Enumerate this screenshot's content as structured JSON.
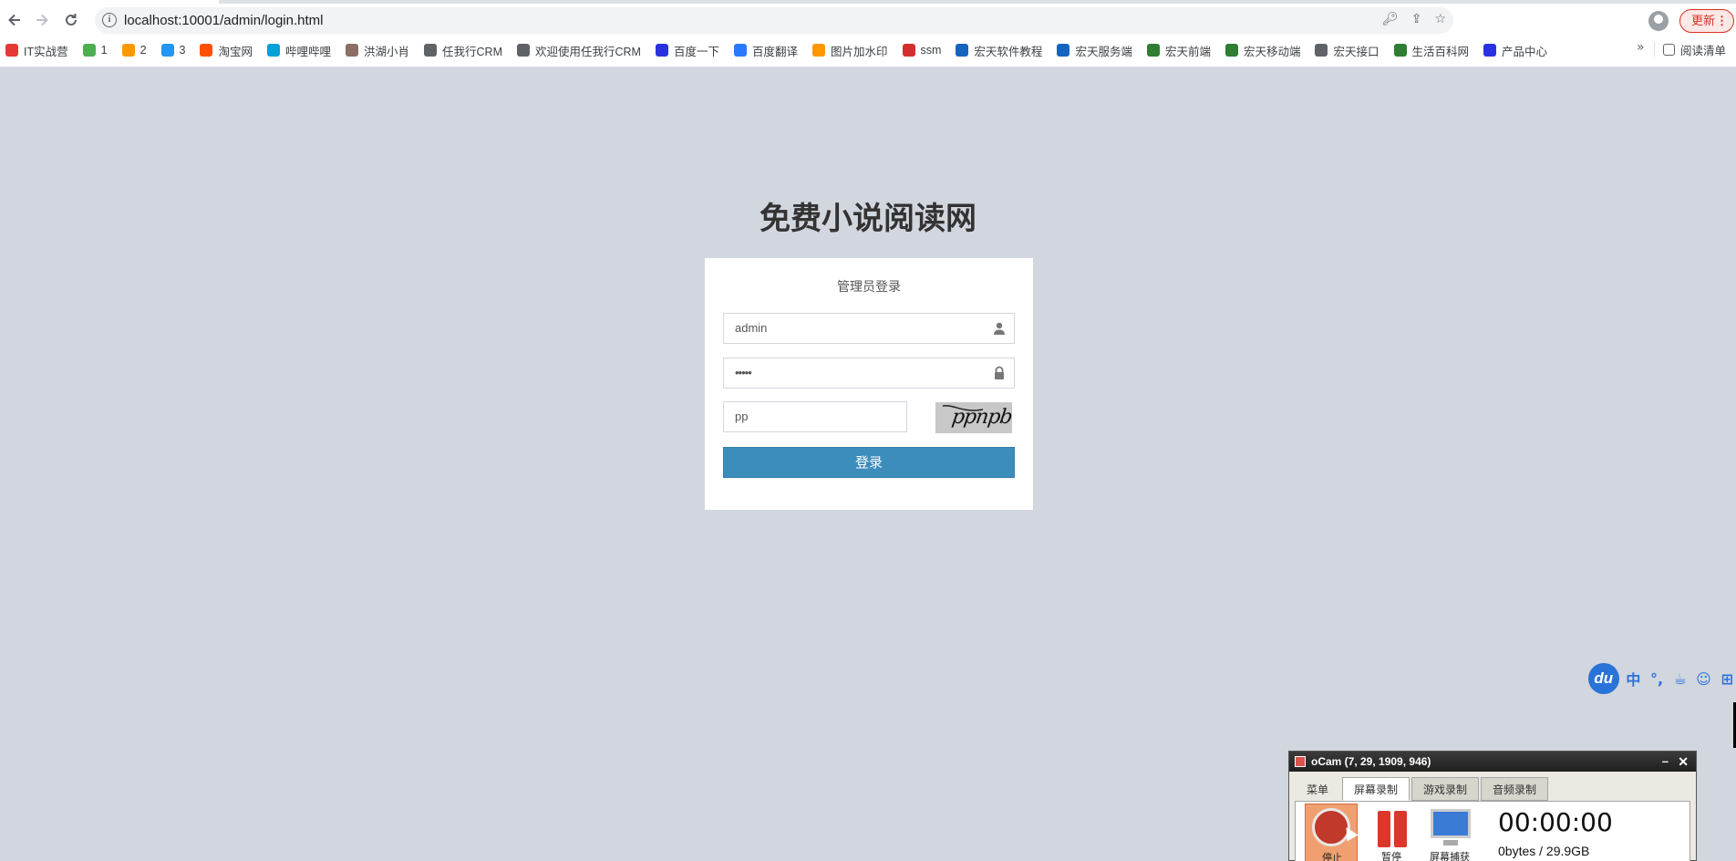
{
  "browser": {
    "url": "localhost:10001/admin/login.html",
    "update_label": "更新",
    "bookmarks": [
      {
        "label": "IT实战营",
        "color": "#e53935"
      },
      {
        "label": "1",
        "color": "#4caf50"
      },
      {
        "label": "2",
        "color": "#ff9800"
      },
      {
        "label": "3",
        "color": "#2196f3"
      },
      {
        "label": "淘宝网",
        "color": "#ff5000"
      },
      {
        "label": "哔哩哔哩",
        "color": "#00a1d6"
      },
      {
        "label": "洪湖小肖",
        "color": "#8d6e63"
      },
      {
        "label": "任我行CRM",
        "color": "#5f6368"
      },
      {
        "label": "欢迎使用任我行CRM",
        "color": "#5f6368"
      },
      {
        "label": "百度一下",
        "color": "#2932e1"
      },
      {
        "label": "百度翻译",
        "color": "#2979ff"
      },
      {
        "label": "图片加水印",
        "color": "#ff9800"
      },
      {
        "label": "ssm",
        "color": "#d32f2f"
      },
      {
        "label": "宏天软件教程",
        "color": "#1565c0"
      },
      {
        "label": "宏天服务端",
        "color": "#1565c0"
      },
      {
        "label": "宏天前端",
        "color": "#2e7d32"
      },
      {
        "label": "宏天移动端",
        "color": "#2e7d32"
      },
      {
        "label": "宏天接口",
        "color": "#5f6368"
      },
      {
        "label": "生活百科网",
        "color": "#2e7d32"
      },
      {
        "label": "产品中心",
        "color": "#2932e1"
      }
    ],
    "more_label": "»",
    "reading_list": "阅读清单"
  },
  "login": {
    "site_title": "免费小说阅读网",
    "box_message": "管理员登录",
    "username_value": "admin",
    "password_value": "•••••",
    "captcha_value": "pp",
    "captcha_image_text": "ppnpb",
    "submit_label": "登录"
  },
  "ime": {
    "logo": "du",
    "items": [
      "中",
      "°,",
      "☕",
      "☺",
      "⊞"
    ]
  },
  "ocam": {
    "title": "oCam (7, 29, 1909, 946)",
    "tabs": [
      "菜单",
      "屏幕录制",
      "游戏录制",
      "音频录制"
    ],
    "active_tab": "屏幕录制",
    "stop_label": "停止",
    "pause_label": "暂停",
    "capture_label": "屏幕捕获",
    "timer": "00:00:00",
    "size": "0bytes / 29.9GB"
  },
  "colors": {
    "page_bg": "#d2d6de",
    "primary": "#3c8dbc"
  }
}
